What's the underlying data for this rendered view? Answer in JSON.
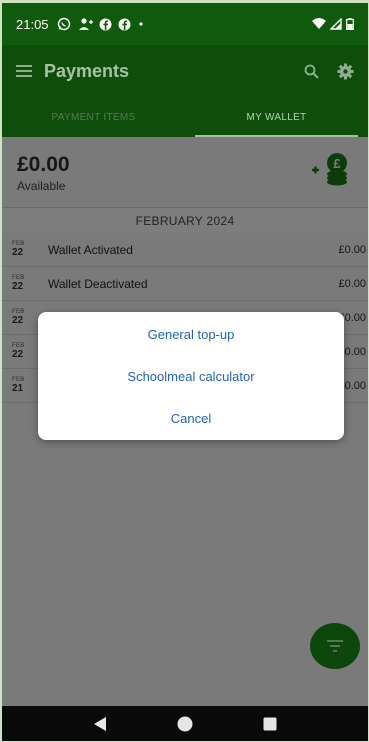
{
  "status_bar": {
    "time": "21:05",
    "icons_left": [
      "whatsapp-icon",
      "person-add-icon",
      "facebook-icon",
      "facebook-icon",
      "dot-icon"
    ],
    "icons_right": [
      "wifi-icon",
      "signal-icon",
      "battery-icon"
    ]
  },
  "app_bar": {
    "title": "Payments",
    "icons": [
      "menu-icon",
      "search-icon",
      "gear-icon"
    ]
  },
  "tabs": [
    {
      "label": "PAYMENT ITEMS",
      "selected": false
    },
    {
      "label": "MY WALLET",
      "selected": true
    }
  ],
  "balance": {
    "amount": "£0.00",
    "label": "Available",
    "icon": "add-money-icon"
  },
  "month_header": "FEBRUARY  2024",
  "transactions": [
    {
      "month": "FEB",
      "day": "22",
      "desc": "Wallet Activated",
      "amount": "£0.00"
    },
    {
      "month": "FEB",
      "day": "22",
      "desc": "Wallet Deactivated",
      "amount": "£0.00"
    },
    {
      "month": "FEB",
      "day": "22",
      "desc": "",
      "amount": "£0.00"
    },
    {
      "month": "FEB",
      "day": "22",
      "desc": "",
      "amount": "£0.00"
    },
    {
      "month": "FEB",
      "day": "21",
      "desc": "",
      "amount": "£0.00"
    }
  ],
  "dialog": {
    "options": [
      "General top-up",
      "Schoolmeal calculator",
      "Cancel"
    ]
  },
  "fab": {
    "icon": "filter-icon"
  },
  "nav_bar": {
    "icons": [
      "back-icon",
      "home-icon",
      "recents-icon"
    ]
  },
  "colors": {
    "status_bar": "#0f5a0b",
    "app_bar": "#0f4d0b",
    "link": "#1f63b8",
    "fab": "#0c460a"
  }
}
